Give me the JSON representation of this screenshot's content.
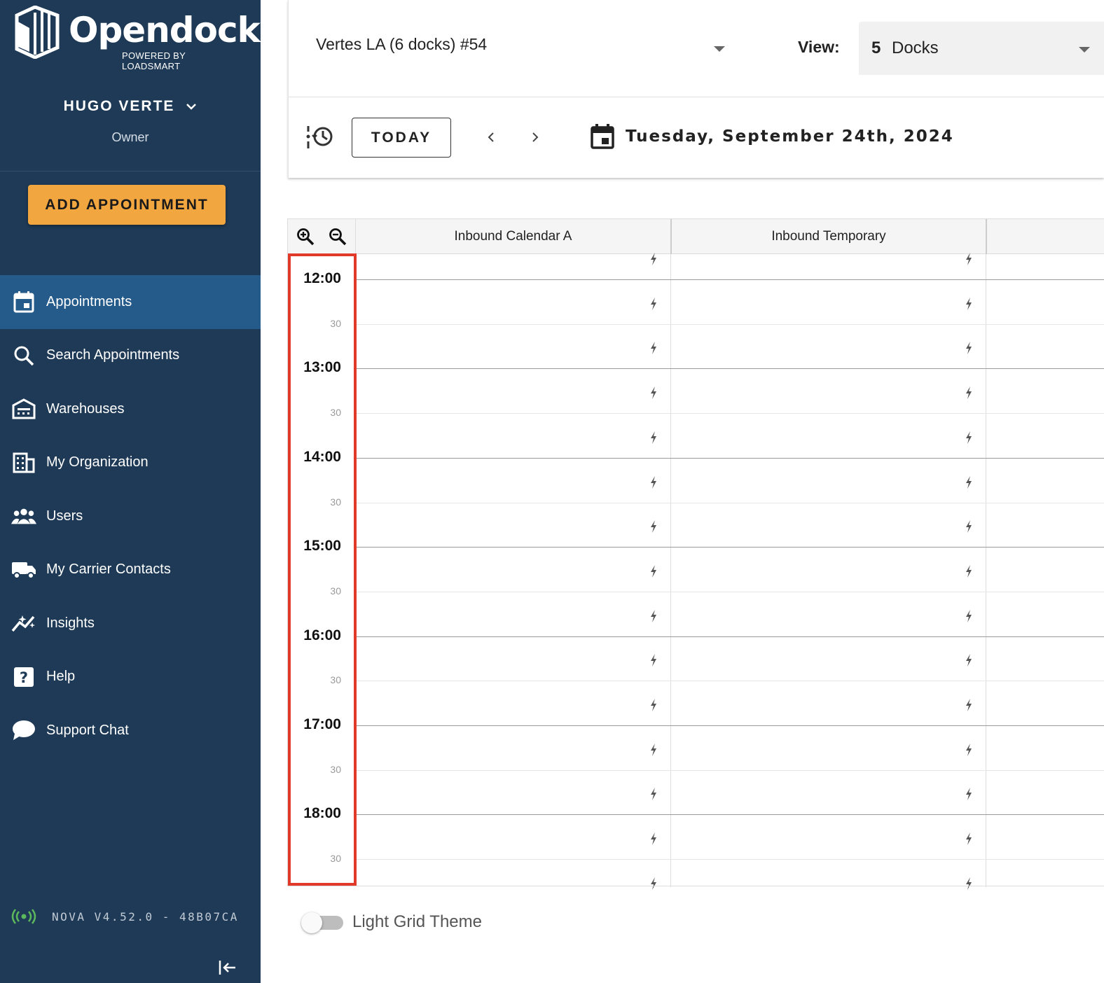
{
  "brand": {
    "name": "Opendock",
    "tagline": "POWERED BY LOADSMART"
  },
  "user": {
    "name": "HUGO VERTE",
    "role": "Owner"
  },
  "actions": {
    "add_appointment": "ADD APPOINTMENT"
  },
  "nav": {
    "items": [
      {
        "label": "Appointments",
        "icon": "calendar-icon",
        "active": true
      },
      {
        "label": "Search Appointments",
        "icon": "search-icon",
        "active": false
      },
      {
        "label": "Warehouses",
        "icon": "warehouse-icon",
        "active": false
      },
      {
        "label": "My Organization",
        "icon": "building-icon",
        "active": false
      },
      {
        "label": "Users",
        "icon": "users-icon",
        "active": false
      },
      {
        "label": "My Carrier Contacts",
        "icon": "truck-icon",
        "active": false
      },
      {
        "label": "Insights",
        "icon": "insights-icon",
        "active": false
      },
      {
        "label": "Help",
        "icon": "help-icon",
        "active": false
      },
      {
        "label": "Support Chat",
        "icon": "chat-icon",
        "active": false
      }
    ]
  },
  "footer": {
    "version": "NOVA V4.52.0 - 48B07CA"
  },
  "toolbar": {
    "warehouse": "Vertes LA (6 docks) #54",
    "view_label": "View:",
    "view_count": "5",
    "view_unit": "Docks",
    "today_label": "TODAY",
    "date": "Tuesday, September 24th, 2024"
  },
  "calendar": {
    "columns": [
      "Inbound Calendar A",
      "Inbound Temporary"
    ],
    "hours": [
      "12:00",
      "13:00",
      "14:00",
      "15:00",
      "16:00",
      "17:00",
      "18:00"
    ],
    "half_label": "30"
  },
  "settings": {
    "light_grid_label": "Light Grid Theme",
    "light_grid_on": false
  },
  "colors": {
    "sidebar": "#1e3a56",
    "active_nav": "#255b8a",
    "accent": "#f2a640",
    "highlight": "#e23a2a",
    "status_online": "#5cb85c"
  }
}
